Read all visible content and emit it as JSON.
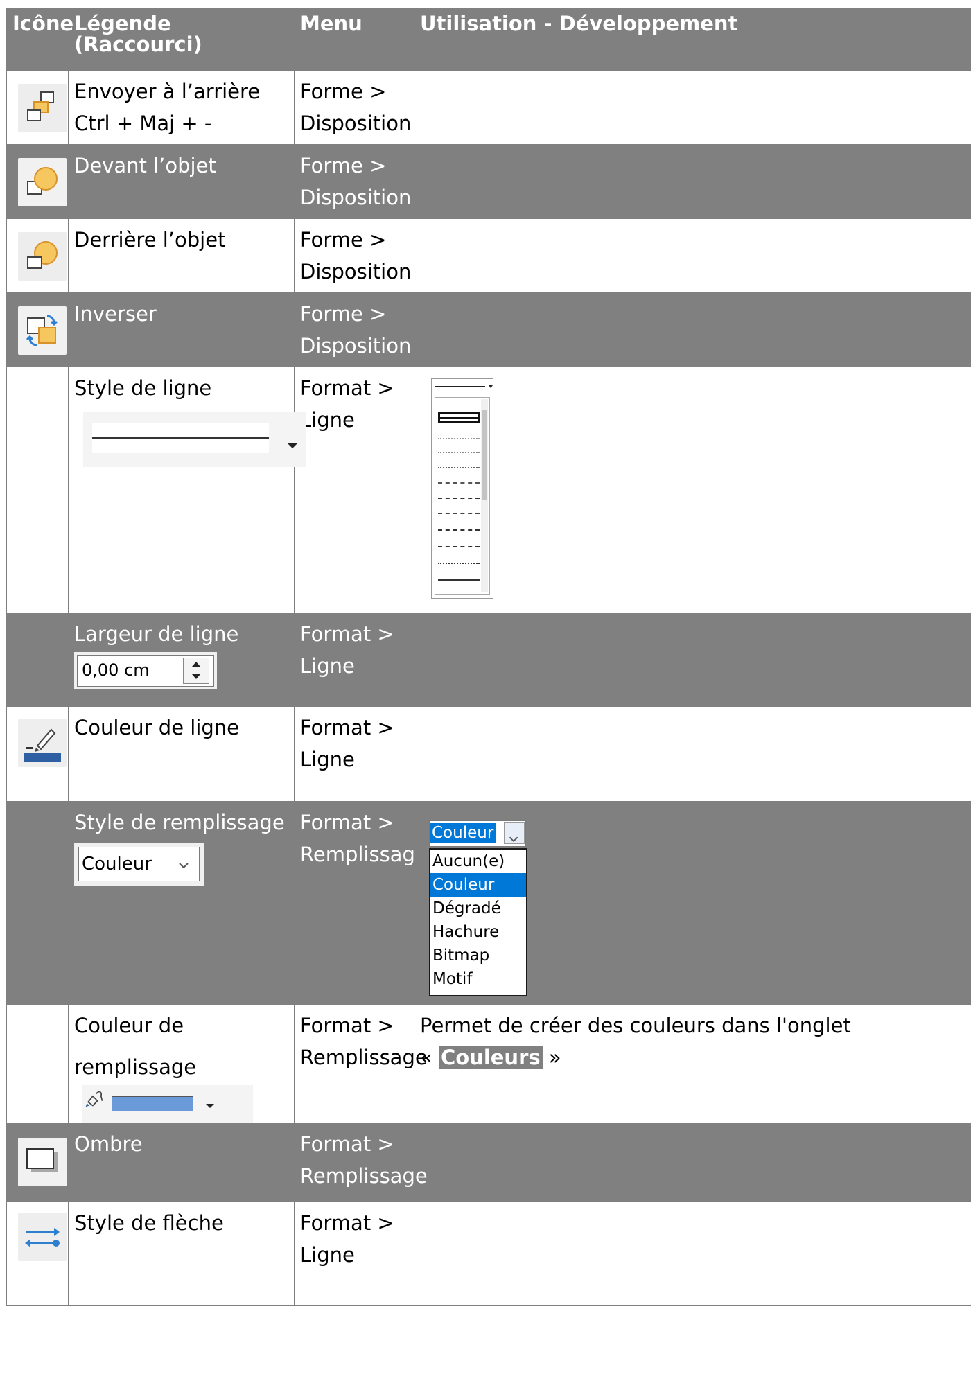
{
  "headers": {
    "icon": "Icône",
    "legend": "Légende (Raccourci)",
    "menu": "Menu",
    "usage": "Utilisation  - Développement"
  },
  "rows": [
    {
      "icon": "send-to-back-icon",
      "title": "Envoyer à l’arrière",
      "shortcut": "Ctrl + Maj + -",
      "menu1": "Forme >",
      "menu2": "Disposition",
      "usage": ""
    },
    {
      "icon": "in-front-of-object-icon",
      "title": "Devant l’objet",
      "menu1": "Forme >",
      "menu2": "Disposition",
      "usage": ""
    },
    {
      "icon": "behind-object-icon",
      "title": "Derrière l’objet",
      "menu1": "Forme >",
      "menu2": "Disposition",
      "usage": ""
    },
    {
      "icon": "reverse-icon",
      "title": "Inverser",
      "menu1": "Forme >",
      "menu2": "Disposition",
      "usage": ""
    },
    {
      "icon": "",
      "title": "Style de ligne",
      "menu1": "Format >",
      "menu2": "Ligne",
      "usage": ""
    },
    {
      "icon": "",
      "title": "Largeur de ligne",
      "width_value": "0,00 cm",
      "menu1": "Format >",
      "menu2": "Ligne",
      "usage": ""
    },
    {
      "icon": "line-color-icon",
      "title": "Couleur de ligne",
      "menu1": "Format >",
      "menu2": "Ligne",
      "usage": ""
    },
    {
      "icon": "",
      "title": "Style de remplissage",
      "select_value": "Couleur",
      "menu1": "Format >",
      "menu2": "Remplissage",
      "usage": ""
    },
    {
      "icon": "",
      "title": "Couleur de remplissage",
      "menu1": "Format >",
      "menu2": "Remplissage",
      "usage_prefix": "Permet de créer des couleurs dans l'onglet",
      "usage_open": "«",
      "usage_chip": "Couleurs",
      "usage_close": "»"
    },
    {
      "icon": "shadow-icon",
      "title": "Ombre",
      "menu1": "Format >",
      "menu2": "Remplissage",
      "usage": ""
    },
    {
      "icon": "arrow-style-icon",
      "title": "Style de flèche",
      "menu1": "Format >",
      "menu2": "Ligne",
      "usage": ""
    }
  ],
  "fill_dropdown": {
    "selected": "Couleur",
    "options": [
      "Aucun(e)",
      "Couleur",
      "Dégradé",
      "Hachure",
      "Bitmap",
      "Motif"
    ],
    "highlighted": "Couleur"
  },
  "colors": {
    "header_bg": "#808080",
    "fill_color": "#6a9bd8",
    "line_color": "#2e5fa3",
    "selection": "#0078d7"
  }
}
